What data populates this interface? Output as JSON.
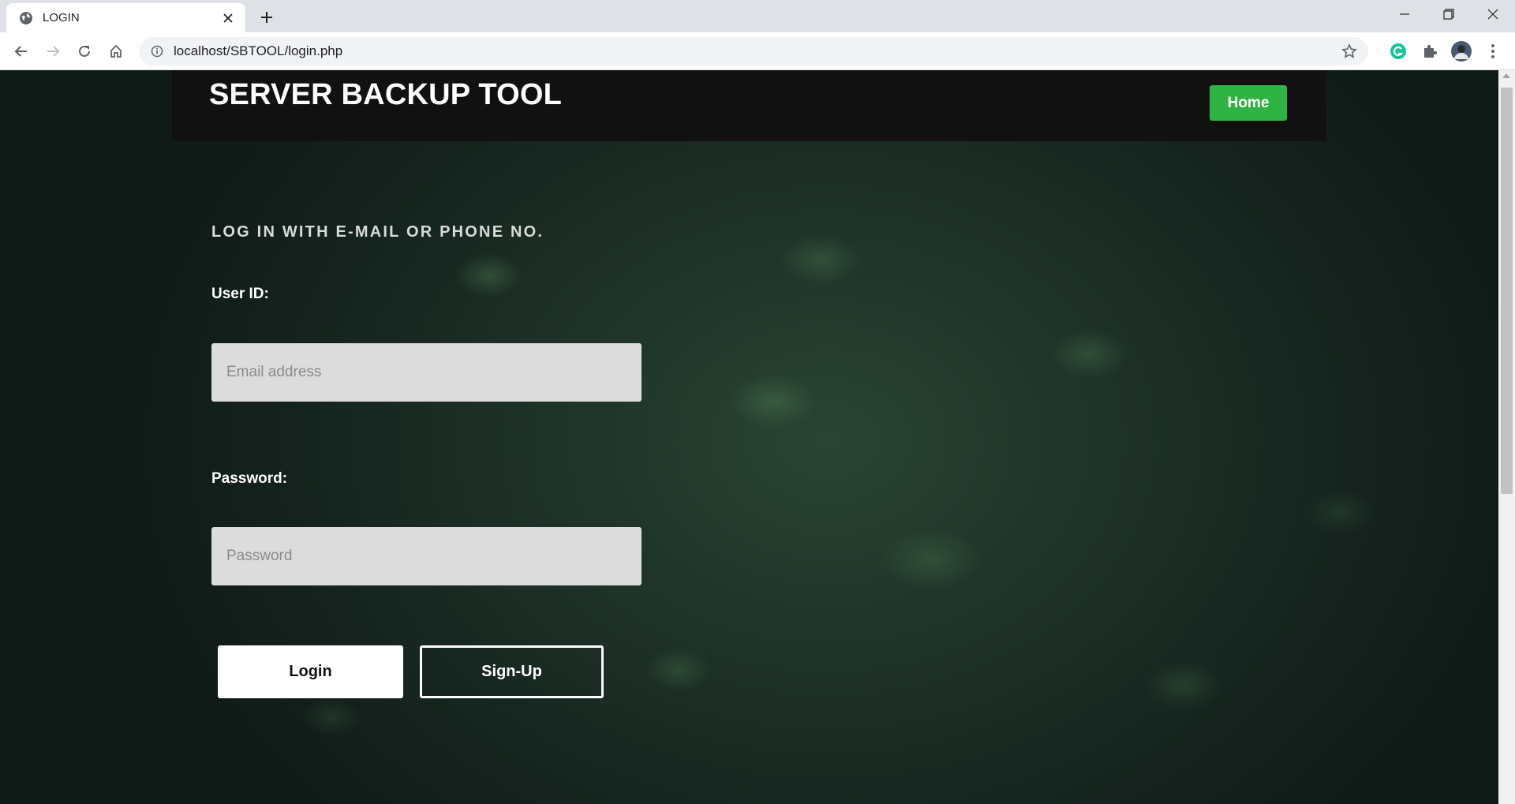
{
  "browser": {
    "tab_title": "LOGIN",
    "tab_icon": "globe-icon",
    "url": "localhost/SBTOOL/login.php"
  },
  "site": {
    "title": "SERVER BACKUP TOOL",
    "home_label": "Home",
    "accent_color": "#2fb344"
  },
  "form": {
    "heading": "LOG IN WITH E-MAIL OR PHONE NO.",
    "user_label": "User ID:",
    "user_placeholder": "Email address",
    "password_label": "Password:",
    "password_placeholder": "Password",
    "login_label": "Login",
    "signup_label": "Sign-Up"
  }
}
